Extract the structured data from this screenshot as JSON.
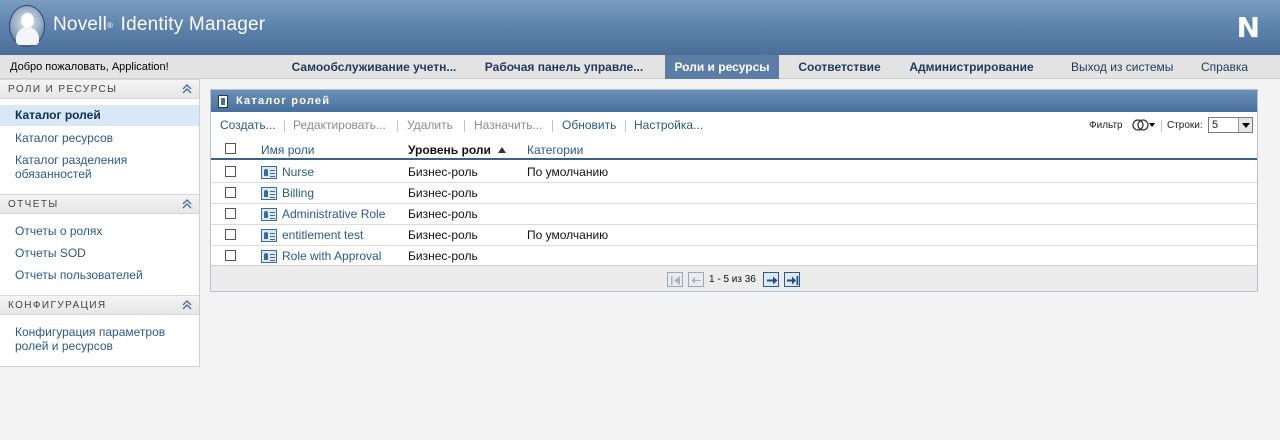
{
  "header": {
    "app_name": "Novell",
    "reg_mark": "®",
    "app_subtitle": " Identity Manager",
    "brand_letter": "N"
  },
  "navbar": {
    "welcome": "Добро пожаловать, Application!",
    "tabs": [
      {
        "label": "Самообслуживание учетн...",
        "active": false
      },
      {
        "label": "Рабочая панель управле...",
        "active": false
      },
      {
        "label": "Роли и ресурсы",
        "active": true
      },
      {
        "label": "Соответствие",
        "active": false
      },
      {
        "label": "Администрирование",
        "active": false
      }
    ],
    "logout": "Выход из системы",
    "help": "Справка"
  },
  "sidebar": {
    "sections": [
      {
        "title": "РОЛИ И РЕСУРСЫ",
        "items": [
          {
            "label": "Каталог ролей",
            "selected": true
          },
          {
            "label": "Каталог ресурсов",
            "selected": false
          },
          {
            "label": "Каталог разделения обязанностей",
            "selected": false
          }
        ]
      },
      {
        "title": "ОТЧЕТЫ",
        "items": [
          {
            "label": "Отчеты о ролях",
            "selected": false
          },
          {
            "label": "Отчеты SOD",
            "selected": false
          },
          {
            "label": "Отчеты пользователей",
            "selected": false
          }
        ]
      },
      {
        "title": "КОНФИГУРАЦИЯ",
        "items": [
          {
            "label": "Конфигурация параметров ролей и ресурсов",
            "selected": false
          }
        ]
      }
    ]
  },
  "panel": {
    "title": "Каталог ролей",
    "toolbar": {
      "create": "Создать...",
      "edit": "Редактировать...",
      "delete": "Удалить",
      "assign": "Назначить...",
      "refresh": "Обновить",
      "settings": "Настройка...",
      "filter_label": "Фильтр",
      "rows_label": "Строки:",
      "rows_value": "5"
    },
    "table": {
      "columns": {
        "name": "Имя роли",
        "level": "Уровень роли",
        "categories": "Категории"
      },
      "rows": [
        {
          "name": "Nurse",
          "level": "Бизнес-роль",
          "category": "По умолчанию"
        },
        {
          "name": "Billing",
          "level": "Бизнес-роль",
          "category": ""
        },
        {
          "name": "Administrative Role",
          "level": "Бизнес-роль",
          "category": ""
        },
        {
          "name": "entitlement test",
          "level": "Бизнес-роль",
          "category": "По умолчанию"
        },
        {
          "name": "Role with Approval",
          "level": "Бизнес-роль",
          "category": ""
        }
      ]
    },
    "pager": {
      "text": "1 - 5 из 36"
    }
  },
  "colors": {
    "header_blue": "#5f84ad",
    "active_tab": "#5c7ea6",
    "link": "#2a5a8a",
    "selected_bg": "#d9e8f4"
  }
}
